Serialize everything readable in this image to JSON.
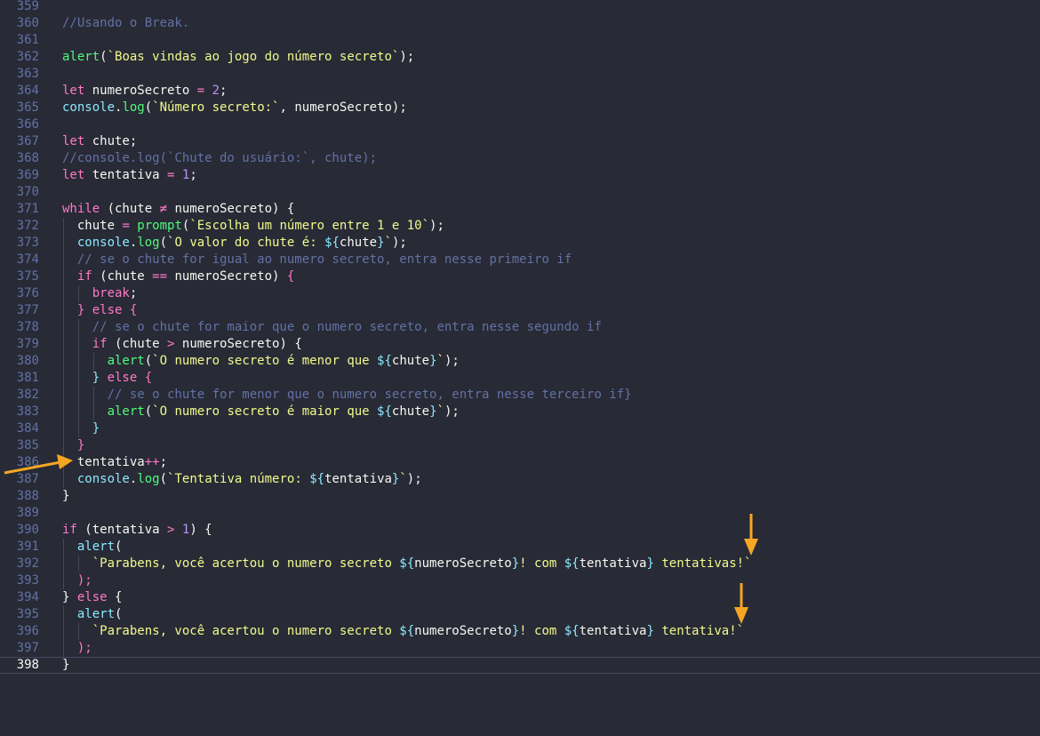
{
  "editor": {
    "theme_colors": {
      "background": "#282a36",
      "keyword": "#ff79c6",
      "function": "#50fa7b",
      "object": "#8be9fd",
      "string": "#f1fa8c",
      "number": "#bd93f9",
      "comment": "#6272a4",
      "plain": "#f8f8f2",
      "annotation_arrow": "#f5a623"
    },
    "active_line": "398",
    "lines": [
      {
        "num": "359",
        "indent": 0,
        "tokens": []
      },
      {
        "num": "360",
        "indent": 0,
        "tokens": [
          {
            "c": "com",
            "t": "//Usando o Break."
          }
        ]
      },
      {
        "num": "361",
        "indent": 0,
        "tokens": []
      },
      {
        "num": "362",
        "indent": 0,
        "tokens": [
          {
            "c": "fn",
            "t": "alert"
          },
          {
            "c": "plain",
            "t": "("
          },
          {
            "c": "str",
            "t": "`Boas vindas ao jogo do número secreto`"
          },
          {
            "c": "plain",
            "t": ");"
          }
        ]
      },
      {
        "num": "363",
        "indent": 0,
        "tokens": []
      },
      {
        "num": "364",
        "indent": 0,
        "tokens": [
          {
            "c": "kw",
            "t": "let "
          },
          {
            "c": "plain",
            "t": "numeroSecreto "
          },
          {
            "c": "kw",
            "t": "= "
          },
          {
            "c": "num",
            "t": "2"
          },
          {
            "c": "plain",
            "t": ";"
          }
        ]
      },
      {
        "num": "365",
        "indent": 0,
        "tokens": [
          {
            "c": "obj",
            "t": "console"
          },
          {
            "c": "plain",
            "t": "."
          },
          {
            "c": "fn",
            "t": "log"
          },
          {
            "c": "plain",
            "t": "("
          },
          {
            "c": "str",
            "t": "`Número secreto:`"
          },
          {
            "c": "plain",
            "t": ", numeroSecreto);"
          }
        ]
      },
      {
        "num": "366",
        "indent": 0,
        "tokens": []
      },
      {
        "num": "367",
        "indent": 0,
        "tokens": [
          {
            "c": "kw",
            "t": "let "
          },
          {
            "c": "plain",
            "t": "chute;"
          }
        ]
      },
      {
        "num": "368",
        "indent": 0,
        "tokens": [
          {
            "c": "com",
            "t": "//console.log(`Chute do usuário:`, chute);"
          }
        ]
      },
      {
        "num": "369",
        "indent": 0,
        "tokens": [
          {
            "c": "kw",
            "t": "let "
          },
          {
            "c": "plain",
            "t": "tentativa "
          },
          {
            "c": "kw",
            "t": "= "
          },
          {
            "c": "num",
            "t": "1"
          },
          {
            "c": "plain",
            "t": ";"
          }
        ]
      },
      {
        "num": "370",
        "indent": 0,
        "tokens": []
      },
      {
        "num": "371",
        "indent": 0,
        "tokens": [
          {
            "c": "kw",
            "t": "while "
          },
          {
            "c": "plain",
            "t": "(chute "
          },
          {
            "c": "kw",
            "t": "≠ "
          },
          {
            "c": "plain",
            "t": "numeroSecreto) {"
          }
        ]
      },
      {
        "num": "372",
        "indent": 1,
        "tokens": [
          {
            "c": "plain",
            "t": "chute "
          },
          {
            "c": "kw",
            "t": "= "
          },
          {
            "c": "fn",
            "t": "prompt"
          },
          {
            "c": "plain",
            "t": "("
          },
          {
            "c": "str",
            "t": "`Escolha um número entre 1 e 10`"
          },
          {
            "c": "plain",
            "t": ");"
          }
        ]
      },
      {
        "num": "373",
        "indent": 1,
        "tokens": [
          {
            "c": "obj",
            "t": "console"
          },
          {
            "c": "plain",
            "t": "."
          },
          {
            "c": "fn",
            "t": "log"
          },
          {
            "c": "plain",
            "t": "("
          },
          {
            "c": "str",
            "t": "`O valor do chute é: "
          },
          {
            "c": "intp",
            "t": "${"
          },
          {
            "c": "plain",
            "t": "chute"
          },
          {
            "c": "intp",
            "t": "}"
          },
          {
            "c": "str",
            "t": "`"
          },
          {
            "c": "plain",
            "t": ");"
          }
        ]
      },
      {
        "num": "374",
        "indent": 1,
        "tokens": [
          {
            "c": "com",
            "t": "// se o chute for igual ao numero secreto, entra nesse primeiro if"
          }
        ]
      },
      {
        "num": "375",
        "indent": 1,
        "tokens": [
          {
            "c": "kw",
            "t": "if "
          },
          {
            "c": "plain",
            "t": "(chute "
          },
          {
            "c": "kw",
            "t": "== "
          },
          {
            "c": "plain",
            "t": "numeroSecreto) "
          },
          {
            "c": "kw",
            "t": "{"
          }
        ]
      },
      {
        "num": "376",
        "indent": 2,
        "tokens": [
          {
            "c": "kw",
            "t": "break"
          },
          {
            "c": "plain",
            "t": ";"
          }
        ]
      },
      {
        "num": "377",
        "indent": 1,
        "tokens": [
          {
            "c": "kw",
            "t": "} else {"
          }
        ]
      },
      {
        "num": "378",
        "indent": 2,
        "tokens": [
          {
            "c": "com",
            "t": "// se o chute for maior que o numero secreto, entra nesse segundo if"
          }
        ]
      },
      {
        "num": "379",
        "indent": 2,
        "tokens": [
          {
            "c": "kw",
            "t": "if "
          },
          {
            "c": "plain",
            "t": "(chute "
          },
          {
            "c": "kw",
            "t": "> "
          },
          {
            "c": "plain",
            "t": "numeroSecreto) {"
          }
        ]
      },
      {
        "num": "380",
        "indent": 3,
        "tokens": [
          {
            "c": "fn",
            "t": "alert"
          },
          {
            "c": "plain",
            "t": "("
          },
          {
            "c": "str",
            "t": "`O numero secreto é menor que "
          },
          {
            "c": "intp",
            "t": "${"
          },
          {
            "c": "plain",
            "t": "chute"
          },
          {
            "c": "intp",
            "t": "}"
          },
          {
            "c": "str",
            "t": "`"
          },
          {
            "c": "plain",
            "t": ");"
          }
        ]
      },
      {
        "num": "381",
        "indent": 2,
        "tokens": [
          {
            "c": "obj",
            "t": "} "
          },
          {
            "c": "kw",
            "t": "else {"
          }
        ]
      },
      {
        "num": "382",
        "indent": 3,
        "tokens": [
          {
            "c": "com",
            "t": "// se o chute for menor que o numero secreto, entra nesse terceiro if}"
          }
        ]
      },
      {
        "num": "383",
        "indent": 3,
        "tokens": [
          {
            "c": "fn",
            "t": "alert"
          },
          {
            "c": "plain",
            "t": "("
          },
          {
            "c": "str",
            "t": "`O numero secreto é maior que "
          },
          {
            "c": "intp",
            "t": "${"
          },
          {
            "c": "plain",
            "t": "chute"
          },
          {
            "c": "intp",
            "t": "}"
          },
          {
            "c": "str",
            "t": "`"
          },
          {
            "c": "plain",
            "t": ");"
          }
        ]
      },
      {
        "num": "384",
        "indent": 2,
        "tokens": [
          {
            "c": "obj",
            "t": "}"
          }
        ]
      },
      {
        "num": "385",
        "indent": 1,
        "tokens": [
          {
            "c": "kw",
            "t": "}"
          }
        ]
      },
      {
        "num": "386",
        "indent": 1,
        "tokens": [
          {
            "c": "plain",
            "t": "tentativa"
          },
          {
            "c": "kw",
            "t": "++"
          },
          {
            "c": "plain",
            "t": ";"
          }
        ]
      },
      {
        "num": "387",
        "indent": 1,
        "tokens": [
          {
            "c": "obj",
            "t": "console"
          },
          {
            "c": "plain",
            "t": "."
          },
          {
            "c": "fn",
            "t": "log"
          },
          {
            "c": "plain",
            "t": "("
          },
          {
            "c": "str",
            "t": "`Tentativa número: "
          },
          {
            "c": "intp",
            "t": "${"
          },
          {
            "c": "plain",
            "t": "tentativa"
          },
          {
            "c": "intp",
            "t": "}"
          },
          {
            "c": "str",
            "t": "`"
          },
          {
            "c": "plain",
            "t": ");"
          }
        ]
      },
      {
        "num": "388",
        "indent": 0,
        "tokens": [
          {
            "c": "plain",
            "t": "}"
          }
        ]
      },
      {
        "num": "389",
        "indent": 0,
        "tokens": []
      },
      {
        "num": "390",
        "indent": 0,
        "tokens": [
          {
            "c": "kw",
            "t": "if "
          },
          {
            "c": "plain",
            "t": "(tentativa "
          },
          {
            "c": "kw",
            "t": "> "
          },
          {
            "c": "num",
            "t": "1"
          },
          {
            "c": "plain",
            "t": ") {"
          }
        ]
      },
      {
        "num": "391",
        "indent": 1,
        "tokens": [
          {
            "c": "obj",
            "t": "alert"
          },
          {
            "c": "plain",
            "t": "("
          }
        ]
      },
      {
        "num": "392",
        "indent": 2,
        "tokens": [
          {
            "c": "str",
            "t": "`Parabens, você acertou o numero secreto "
          },
          {
            "c": "intp",
            "t": "${"
          },
          {
            "c": "plain",
            "t": "numeroSecreto"
          },
          {
            "c": "intp",
            "t": "}"
          },
          {
            "c": "str",
            "t": "! com "
          },
          {
            "c": "intp",
            "t": "${"
          },
          {
            "c": "plain",
            "t": "tentativa"
          },
          {
            "c": "intp",
            "t": "}"
          },
          {
            "c": "str",
            "t": " tentativas!`"
          }
        ]
      },
      {
        "num": "393",
        "indent": 1,
        "tokens": [
          {
            "c": "kw",
            "t": ");"
          }
        ]
      },
      {
        "num": "394",
        "indent": 0,
        "tokens": [
          {
            "c": "plain",
            "t": "} "
          },
          {
            "c": "kw",
            "t": "else "
          },
          {
            "c": "plain",
            "t": "{"
          }
        ]
      },
      {
        "num": "395",
        "indent": 1,
        "tokens": [
          {
            "c": "obj",
            "t": "alert"
          },
          {
            "c": "plain",
            "t": "("
          }
        ]
      },
      {
        "num": "396",
        "indent": 2,
        "tokens": [
          {
            "c": "str",
            "t": "`Parabens, você acertou o numero secreto "
          },
          {
            "c": "intp",
            "t": "${"
          },
          {
            "c": "plain",
            "t": "numeroSecreto"
          },
          {
            "c": "intp",
            "t": "}"
          },
          {
            "c": "str",
            "t": "! com "
          },
          {
            "c": "intp",
            "t": "${"
          },
          {
            "c": "plain",
            "t": "tentativa"
          },
          {
            "c": "intp",
            "t": "}"
          },
          {
            "c": "str",
            "t": " tentativa!`"
          }
        ]
      },
      {
        "num": "397",
        "indent": 1,
        "tokens": [
          {
            "c": "kw",
            "t": ");"
          }
        ]
      },
      {
        "num": "398",
        "indent": 0,
        "tokens": [
          {
            "c": "plain",
            "t": "}"
          }
        ]
      }
    ]
  }
}
